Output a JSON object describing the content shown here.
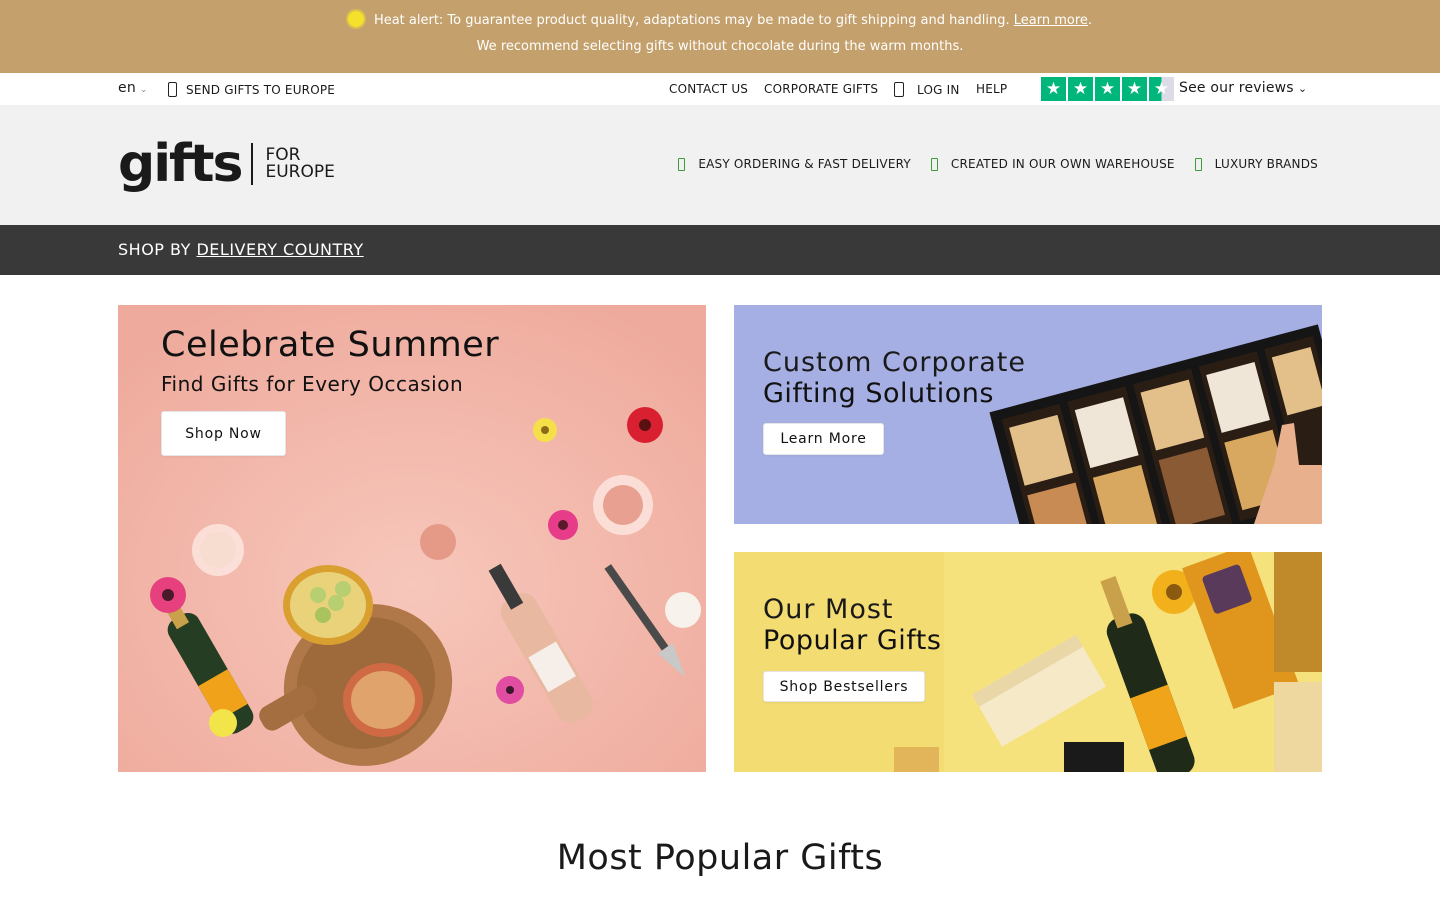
{
  "alert": {
    "line1": "Heat alert: To guarantee product quality, adaptations may be made to gift shipping and handling.",
    "link": "Learn more",
    "line2": "We recommend selecting gifts without chocolate during the warm months."
  },
  "utility": {
    "language": "en",
    "send_gifts": "SEND GIFTS TO EUROPE",
    "contact": "CONTACT US",
    "corporate": "CORPORATE GIFTS",
    "login": "LOG IN",
    "help": "HELP",
    "reviews": "See our reviews",
    "rating_stars": 4.5
  },
  "header": {
    "logo_main": "gifts",
    "logo_sub_1": "FOR",
    "logo_sub_2": "EUROPE",
    "usps": [
      "EASY ORDERING & FAST DELIVERY",
      "CREATED IN OUR OWN WAREHOUSE",
      "LUXURY BRANDS"
    ]
  },
  "nav": {
    "prefix": "SHOP BY",
    "link": "DELIVERY COUNTRY"
  },
  "hero": {
    "summer": {
      "title": "Celebrate Summer",
      "subtitle": "Find Gifts for Every Occasion",
      "button": "Shop Now"
    },
    "corporate": {
      "title_light": "Custom Corporate",
      "title_bold": "Gifting Solutions",
      "button": "Learn More"
    },
    "popular": {
      "title_light": "Our Most",
      "title_bold": "Popular Gifts",
      "button": "Shop Bestsellers"
    }
  },
  "section": {
    "title": "Most Popular Gifts"
  },
  "colors": {
    "alert_bg": "#c4a06c",
    "nav_bg": "#393939",
    "header_bg": "#f1f1f2",
    "trustpilot": "#00b67a"
  }
}
